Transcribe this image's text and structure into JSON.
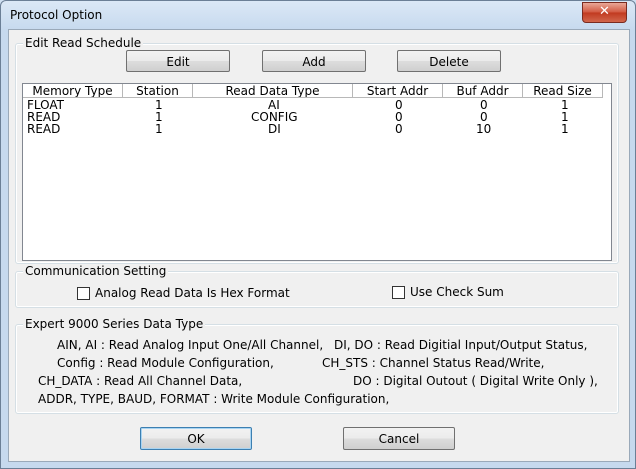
{
  "window": {
    "title": "Protocol Option",
    "close_glyph": "✕"
  },
  "schedule": {
    "group_label": "Edit Read Schedule",
    "edit_label": "Edit",
    "add_label": "Add",
    "delete_label": "Delete",
    "columns": [
      "Memory Type",
      "Station",
      "Read Data Type",
      "Start Addr",
      "Buf Addr",
      "Read Size"
    ],
    "rows": [
      [
        "FLOAT",
        "1",
        "AI",
        "0",
        "0",
        "1"
      ],
      [
        "READ",
        "1",
        "CONFIG",
        "0",
        "0",
        "1"
      ],
      [
        "READ",
        "1",
        "DI",
        "0",
        "10",
        "1"
      ]
    ]
  },
  "comm": {
    "group_label": "Communication Setting",
    "hex_label": "Analog Read Data Is Hex Format",
    "checksum_label": "Use Check Sum"
  },
  "expert": {
    "group_label": "Expert 9000 Series Data Type",
    "l1a": "AIN, AI : Read Analog Input One/All Channel,",
    "l1b": "DI, DO : Read Digitial Input/Output Status,",
    "l2a": "Config : Read Module Configuration,",
    "l2b": "CH_STS : Channel Status Read/Write,",
    "l3a": "CH_DATA : Read All Channel Data,",
    "l3b": "DO : Digital Outout ( Digital Write Only ),",
    "l4": "ADDR, TYPE, BAUD,  FORMAT : Write Module Configuration,"
  },
  "footer": {
    "ok_label": "OK",
    "cancel_label": "Cancel"
  }
}
